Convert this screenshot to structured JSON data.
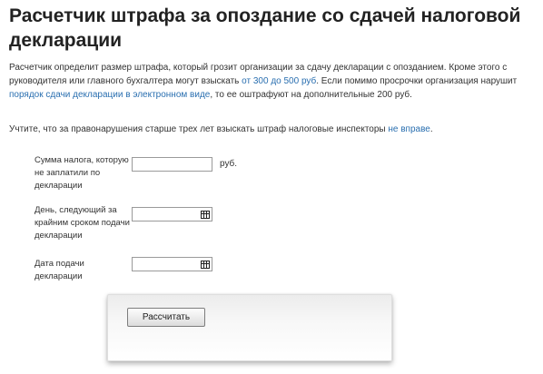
{
  "page": {
    "title": "Расчетчик штрафа за опоздание со сдачей налоговой декларации"
  },
  "intro": {
    "text_before_link1": "Расчетчик определит размер штрафа, который грозит организации за сдачу декларации с опозданием. Кроме этого с руководителя или главного бухгалтера могут взыскать ",
    "link1": "от 300 до 500 руб",
    "text_between": ". Если помимо просрочки организация нарушит ",
    "link2": "порядок сдачи декларации в электронном виде",
    "text_after": ", то ее оштрафуют на дополнительные 200 руб."
  },
  "note": {
    "text_before": "Учтите, что за правонарушения старше трех лет взыскать штраф налоговые инспекторы ",
    "link": "не вправе",
    "text_after": "."
  },
  "form": {
    "tax_amount_label": "Сумма налога, которую не заплатили по декларации",
    "tax_amount_value": "",
    "tax_amount_unit": "руб.",
    "deadline_label": "День, следующий за крайним сроком подачи декларации",
    "deadline_value": "",
    "submission_label": "Дата подачи декларации",
    "submission_value": "",
    "calculate_label": "Рассчитать"
  },
  "icons": {
    "calendar": "calendar-icon"
  },
  "colors": {
    "link": "#2a6fb0",
    "heading": "#222222",
    "text": "#333333"
  }
}
